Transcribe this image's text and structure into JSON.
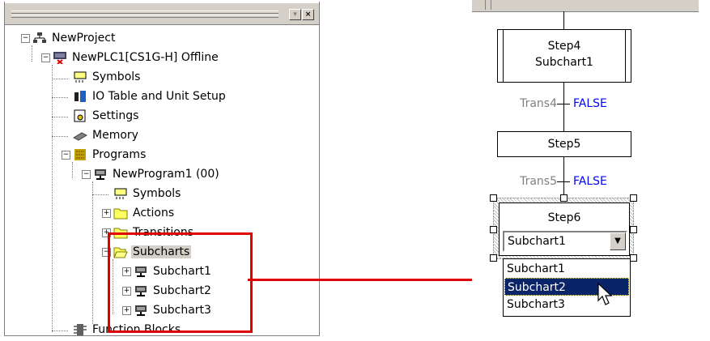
{
  "tree": {
    "titlebar_buttons": [
      "▾",
      "×"
    ],
    "items": [
      {
        "label": "NewProject",
        "icon": "network-icon"
      },
      {
        "label": "NewPLC1[CS1G-H] Offline",
        "icon": "plc-offline-icon"
      },
      {
        "label": "Symbols",
        "icon": "symbols-icon"
      },
      {
        "label": "IO Table and Unit Setup",
        "icon": "io-table-icon"
      },
      {
        "label": "Settings",
        "icon": "settings-icon"
      },
      {
        "label": "Memory",
        "icon": "memory-icon"
      },
      {
        "label": "Programs",
        "icon": "programs-icon"
      },
      {
        "label": "NewProgram1 (00)",
        "icon": "program-icon"
      },
      {
        "label": "Symbols",
        "icon": "symbols-icon"
      },
      {
        "label": "Actions",
        "icon": "folder-icon"
      },
      {
        "label": "Transitions",
        "icon": "folder-icon"
      },
      {
        "label": "Subcharts",
        "icon": "folder-open-icon",
        "selected": true
      },
      {
        "label": "Subchart1",
        "icon": "subchart-icon"
      },
      {
        "label": "Subchart2",
        "icon": "subchart-icon"
      },
      {
        "label": "Subchart3",
        "icon": "subchart-icon"
      },
      {
        "label": "Function Blocks",
        "icon": "function-block-icon"
      }
    ]
  },
  "sfc": {
    "steps": [
      {
        "name": "Step4",
        "sub": "Subchart1"
      },
      {
        "name": "Step5"
      },
      {
        "name": "Step6"
      }
    ],
    "transitions": [
      {
        "name": "Trans4",
        "value": "FALSE"
      },
      {
        "name": "Trans5",
        "value": "FALSE"
      }
    ],
    "combo": {
      "value": "Subchart1",
      "arrow": "▼"
    },
    "dropdown_options": [
      "Subchart1",
      "Subchart2",
      "Subchart3"
    ],
    "highlighted_option": "Subchart2"
  },
  "colors": {
    "highlight_box": "#e00000",
    "selection": "#0a246a",
    "transition_value": "#0000ff"
  }
}
